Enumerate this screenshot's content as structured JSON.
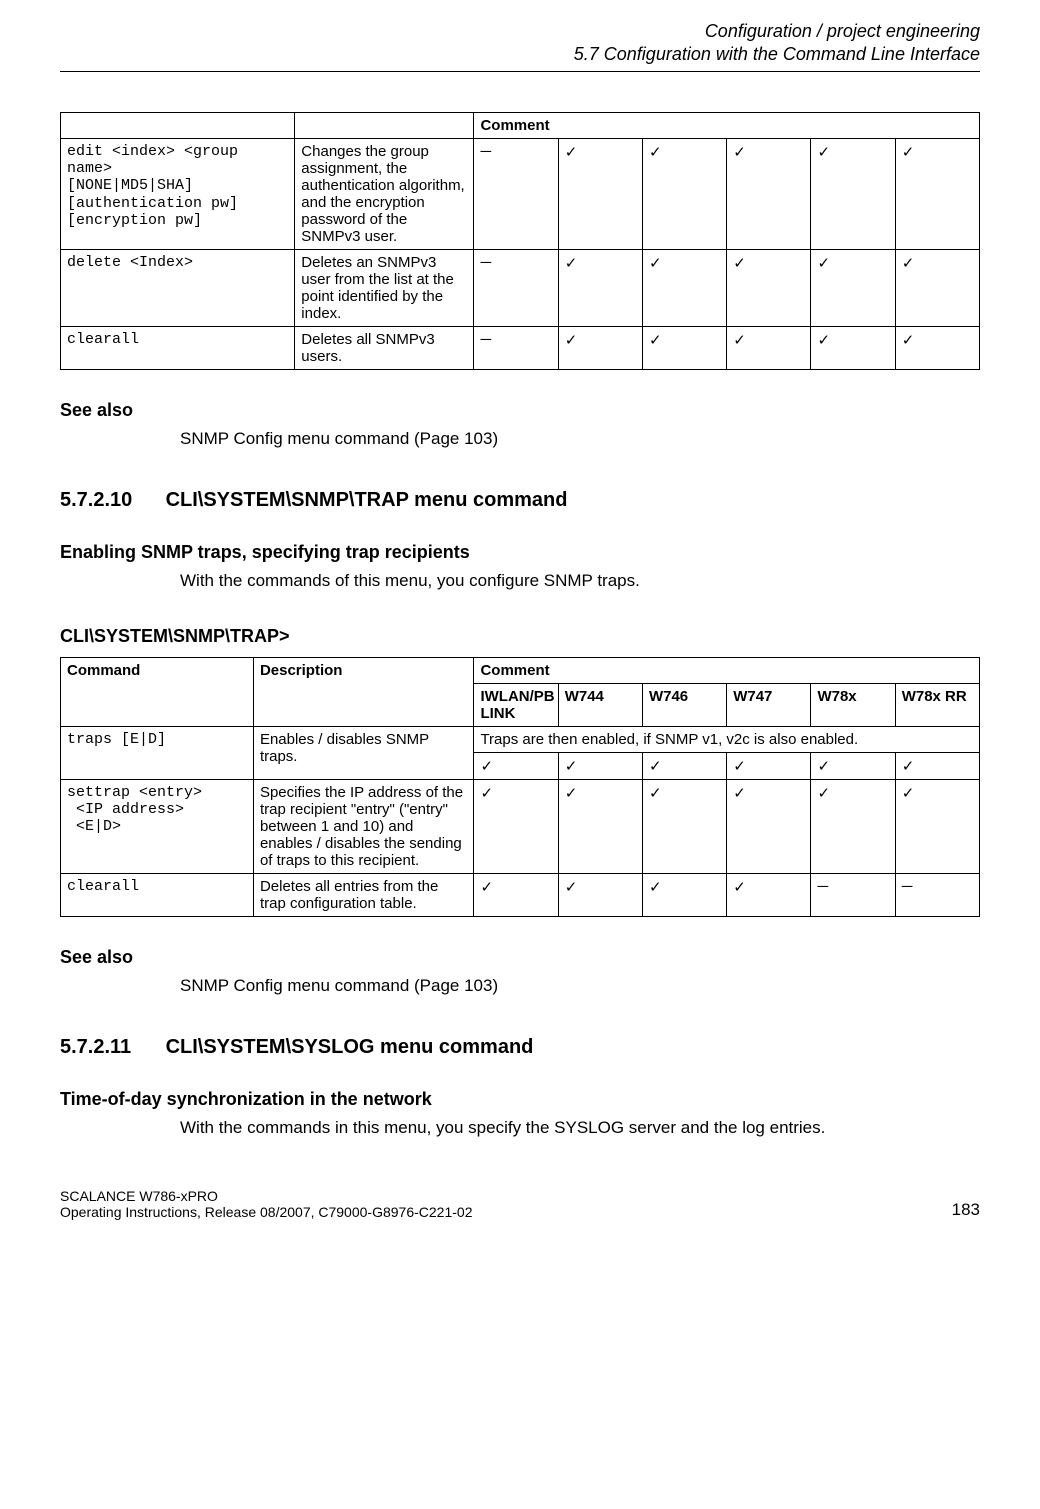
{
  "header": {
    "line1": "Configuration / project engineering",
    "line2": "5.7 Configuration with the Command Line Interface"
  },
  "table1": {
    "header": {
      "col1": "",
      "col2": "",
      "col3": "Comment"
    },
    "rows": [
      {
        "command": "edit <index> <group name>\n[NONE|MD5|SHA]\n[authentication pw]\n[encryption pw]",
        "description": "Changes the group assignment, the authentication algorithm, and the encryption password of the SNMPv3 user.",
        "cells": [
          "─",
          "✓",
          "✓",
          "✓",
          "✓",
          "✓"
        ]
      },
      {
        "command": "delete <Index>",
        "description": "Deletes an SNMPv3 user from the list at the point identified by the index.",
        "cells": [
          "─",
          "✓",
          "✓",
          "✓",
          "✓",
          "✓"
        ]
      },
      {
        "command": "clearall",
        "description": "Deletes all SNMPv3 users.",
        "cells": [
          "─",
          "✓",
          "✓",
          "✓",
          "✓",
          "✓"
        ]
      }
    ]
  },
  "see_also_label": "See also",
  "see_also1": "SNMP Config menu command (Page 103)",
  "section10": {
    "num": "5.7.2.10",
    "title": "CLI\\SYSTEM\\SNMP\\TRAP menu command",
    "sub": "Enabling SNMP traps, specifying trap recipients",
    "body": "With the commands of this menu, you configure SNMP traps.",
    "path": "CLI\\SYSTEM\\SNMP\\TRAP>"
  },
  "table2": {
    "header": {
      "command": "Command",
      "description": "Description",
      "comment": "Comment",
      "cols": [
        "IWLAN/PB LINK",
        "W744",
        "W746",
        "W747",
        "W78x",
        "W78x RR"
      ]
    },
    "rows": [
      {
        "command": "traps [E|D]",
        "description": "Enables / disables SNMP traps.",
        "note": "Traps are then enabled, if SNMP v1, v2c is also enabled.",
        "cells": [
          "✓",
          "✓",
          "✓",
          "✓",
          "✓",
          "✓"
        ]
      },
      {
        "command": "settrap <entry>\n <IP address>\n <E|D>",
        "description": "Specifies the IP address of the trap recipient \"entry\" (\"entry\" between 1 and 10) and enables / disables the sending of traps to this recipient.",
        "cells": [
          "✓",
          "✓",
          "✓",
          "✓",
          "✓",
          "✓"
        ]
      },
      {
        "command": "clearall",
        "description": "Deletes all entries from the trap configuration table.",
        "cells": [
          "✓",
          "✓",
          "✓",
          "✓",
          "─",
          "─"
        ]
      }
    ]
  },
  "see_also2": "SNMP Config menu command (Page 103)",
  "section11": {
    "num": "5.7.2.11",
    "title": "CLI\\SYSTEM\\SYSLOG menu command",
    "sub": "Time-of-day synchronization in the network",
    "body": "With the commands in this menu, you specify the SYSLOG server and the log entries."
  },
  "footer": {
    "line1": "SCALANCE W786-xPRO",
    "line2": "Operating Instructions, Release 08/2007, C79000-G8976-C221-02",
    "page": "183"
  }
}
